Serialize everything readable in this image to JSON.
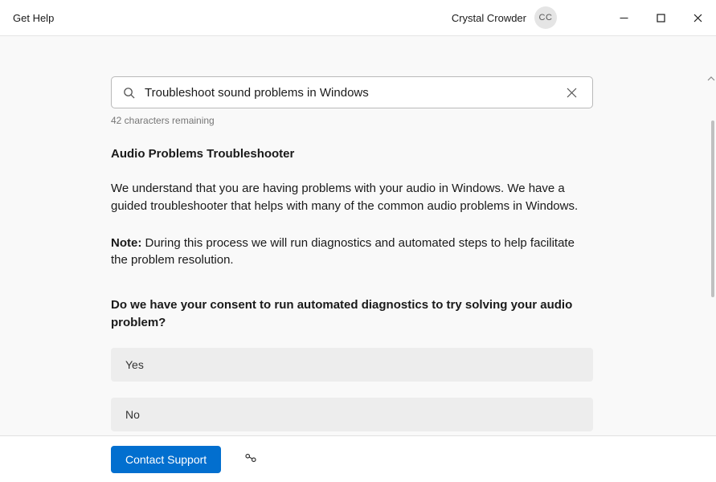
{
  "titlebar": {
    "app_title": "Get Help",
    "user_name": "Crystal Crowder",
    "user_initials": "CC"
  },
  "search": {
    "value": "Troubleshoot sound problems in Windows",
    "chars_remaining": "42 characters remaining"
  },
  "content": {
    "heading": "Audio Problems Troubleshooter",
    "intro": "We understand that you are having problems with your audio in Windows. We have a guided troubleshooter that helps with many of the common audio problems in Windows.",
    "note_label": "Note:",
    "note_body": " During this process we will run diagnostics and automated steps to help facilitate the problem resolution.",
    "question": "Do we have your consent to run automated diagnostics to try solving your audio problem?",
    "options": {
      "yes": "Yes",
      "no": "No"
    }
  },
  "footer": {
    "contact_label": "Contact Support"
  }
}
